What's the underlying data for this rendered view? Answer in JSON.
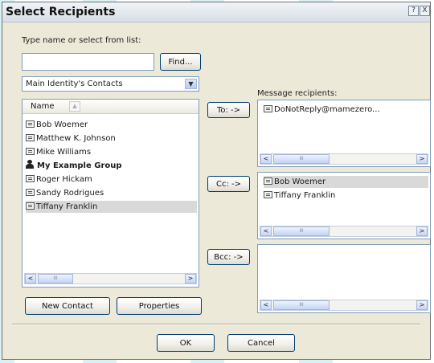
{
  "window": {
    "title": "Select Recipients",
    "help_glyph": "?",
    "close_glyph": "X"
  },
  "search": {
    "label": "Type name or select from list:",
    "value": "",
    "find_label": "Find..."
  },
  "address_book": {
    "selected": "Main Identity's Contacts",
    "arrow": "▼"
  },
  "contacts": {
    "column_name": "Name",
    "sort_glyph": "▲",
    "items": [
      {
        "name": "Bob Woemer"
      },
      {
        "name": "Matthew K. Johnson"
      },
      {
        "name": "Mike Williams"
      },
      {
        "name": "My Example Group"
      },
      {
        "name": "Roger Hickam"
      },
      {
        "name": "Sandy Rodrigues"
      },
      {
        "name": "Tiffany Franklin"
      }
    ]
  },
  "buttons": {
    "to": "To: ->",
    "cc": "Cc: ->",
    "bcc": "Bcc: ->",
    "new_contact": "New Contact",
    "properties": "Properties",
    "ok": "OK",
    "cancel": "Cancel"
  },
  "recipients": {
    "label": "Message recipients:",
    "to_list": [
      "DoNotReply@mamezero..."
    ],
    "cc_list": [
      "Bob Woemer",
      "Tiffany Franklin"
    ],
    "bcc_list": []
  },
  "scroll": {
    "left": "<",
    "right": ">",
    "grip": "III"
  }
}
